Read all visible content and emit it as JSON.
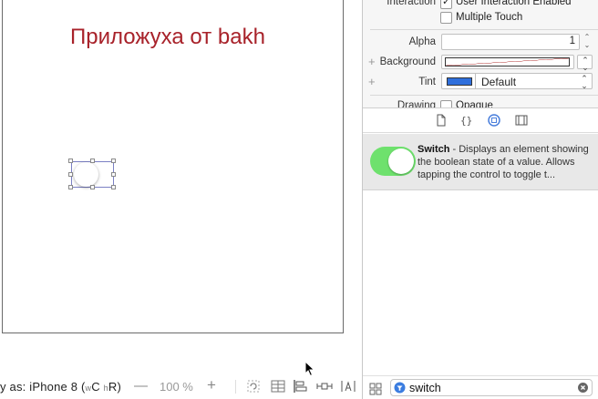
{
  "canvas": {
    "app_title": "Приложуха от bakh"
  },
  "bottom_bar": {
    "view_as_prefix": "y as: iPhone 8 (",
    "size_w": "w",
    "size_c": "C",
    "size_h": "h",
    "size_r": "R)",
    "zoom_minus": "—",
    "zoom_value": "100 %",
    "zoom_plus": "+"
  },
  "inspector": {
    "interaction_label": "Interaction",
    "user_interaction_label": "User Interaction Enabled",
    "user_interaction_checked": true,
    "multiple_touch_label": "Multiple Touch",
    "multiple_touch_checked": false,
    "alpha_label": "Alpha",
    "alpha_value": "1",
    "background_label": "Background",
    "tint_label": "Tint",
    "tint_value": "Default",
    "tint_color": "#2f6fdc",
    "drawing_label": "Drawing",
    "opaque_label": "Opaque",
    "plus_symbol": "+"
  },
  "library": {
    "item_title": "Switch",
    "item_description": " - Displays an element showing the boolean state of a value. Allows tapping the control to toggle t...",
    "switch_color": "#6ee16d",
    "filter_value": "switch"
  }
}
